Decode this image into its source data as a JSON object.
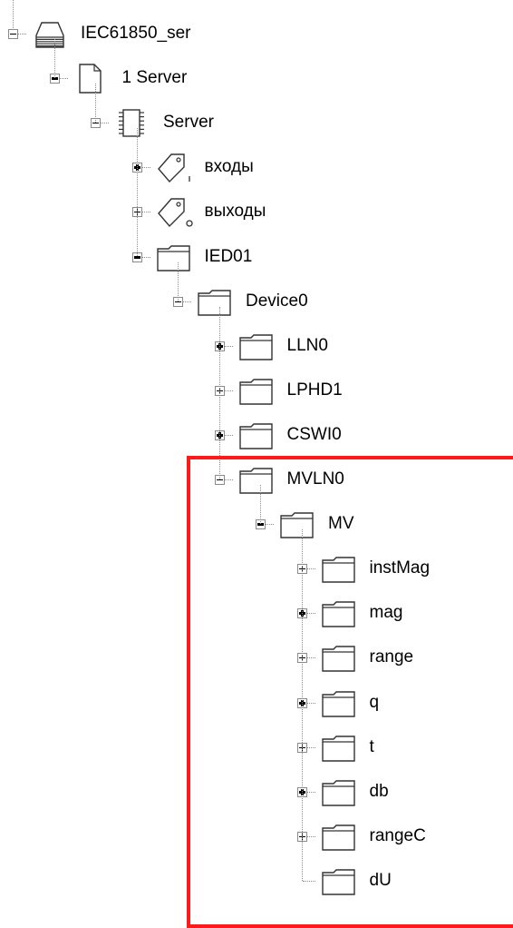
{
  "tree": [
    {
      "label": "IEC61850_ser",
      "icon": "stack-icon",
      "expander": "minus",
      "bold": false
    },
    {
      "label": "1 Server",
      "icon": "document-icon",
      "expander": "minus",
      "bold": true
    },
    {
      "label": "Server",
      "icon": "chip-icon",
      "expander": "minus",
      "bold": false
    },
    {
      "label": "входы",
      "icon": "tag-input-icon",
      "expander": "plus",
      "bold": true
    },
    {
      "label": "выходы",
      "icon": "tag-output-icon",
      "expander": "plus",
      "bold": false
    },
    {
      "label": "IED01",
      "icon": "folder-icon",
      "expander": "minus",
      "bold": true
    },
    {
      "label": "Device0",
      "icon": "folder-icon",
      "expander": "minus",
      "bold": false
    },
    {
      "label": "LLN0",
      "icon": "folder-icon",
      "expander": "plus",
      "bold": true
    },
    {
      "label": "LPHD1",
      "icon": "folder-icon",
      "expander": "plus",
      "bold": false
    },
    {
      "label": "CSWI0",
      "icon": "folder-icon",
      "expander": "plus",
      "bold": true
    },
    {
      "label": "MVLN0",
      "icon": "folder-icon",
      "expander": "minus",
      "bold": false
    },
    {
      "label": "MV",
      "icon": "folder-icon",
      "expander": "minus",
      "bold": true
    },
    {
      "label": "instMag",
      "icon": "folder-icon",
      "expander": "plus",
      "bold": false
    },
    {
      "label": "mag",
      "icon": "folder-icon",
      "expander": "plus",
      "bold": true
    },
    {
      "label": "range",
      "icon": "folder-icon",
      "expander": "plus",
      "bold": false
    },
    {
      "label": "q",
      "icon": "folder-icon",
      "expander": "plus",
      "bold": true
    },
    {
      "label": "t",
      "icon": "folder-icon",
      "expander": "plus",
      "bold": false
    },
    {
      "label": "db",
      "icon": "folder-icon",
      "expander": "plus",
      "bold": true
    },
    {
      "label": "rangeC",
      "icon": "folder-icon",
      "expander": "plus",
      "bold": false
    },
    {
      "label": "dU",
      "icon": "folder-icon",
      "expander": "none",
      "bold": false
    }
  ],
  "colors": {
    "highlight": "#ff1a1a",
    "line": "#8c8c8c",
    "icon_stroke": "#333333"
  }
}
